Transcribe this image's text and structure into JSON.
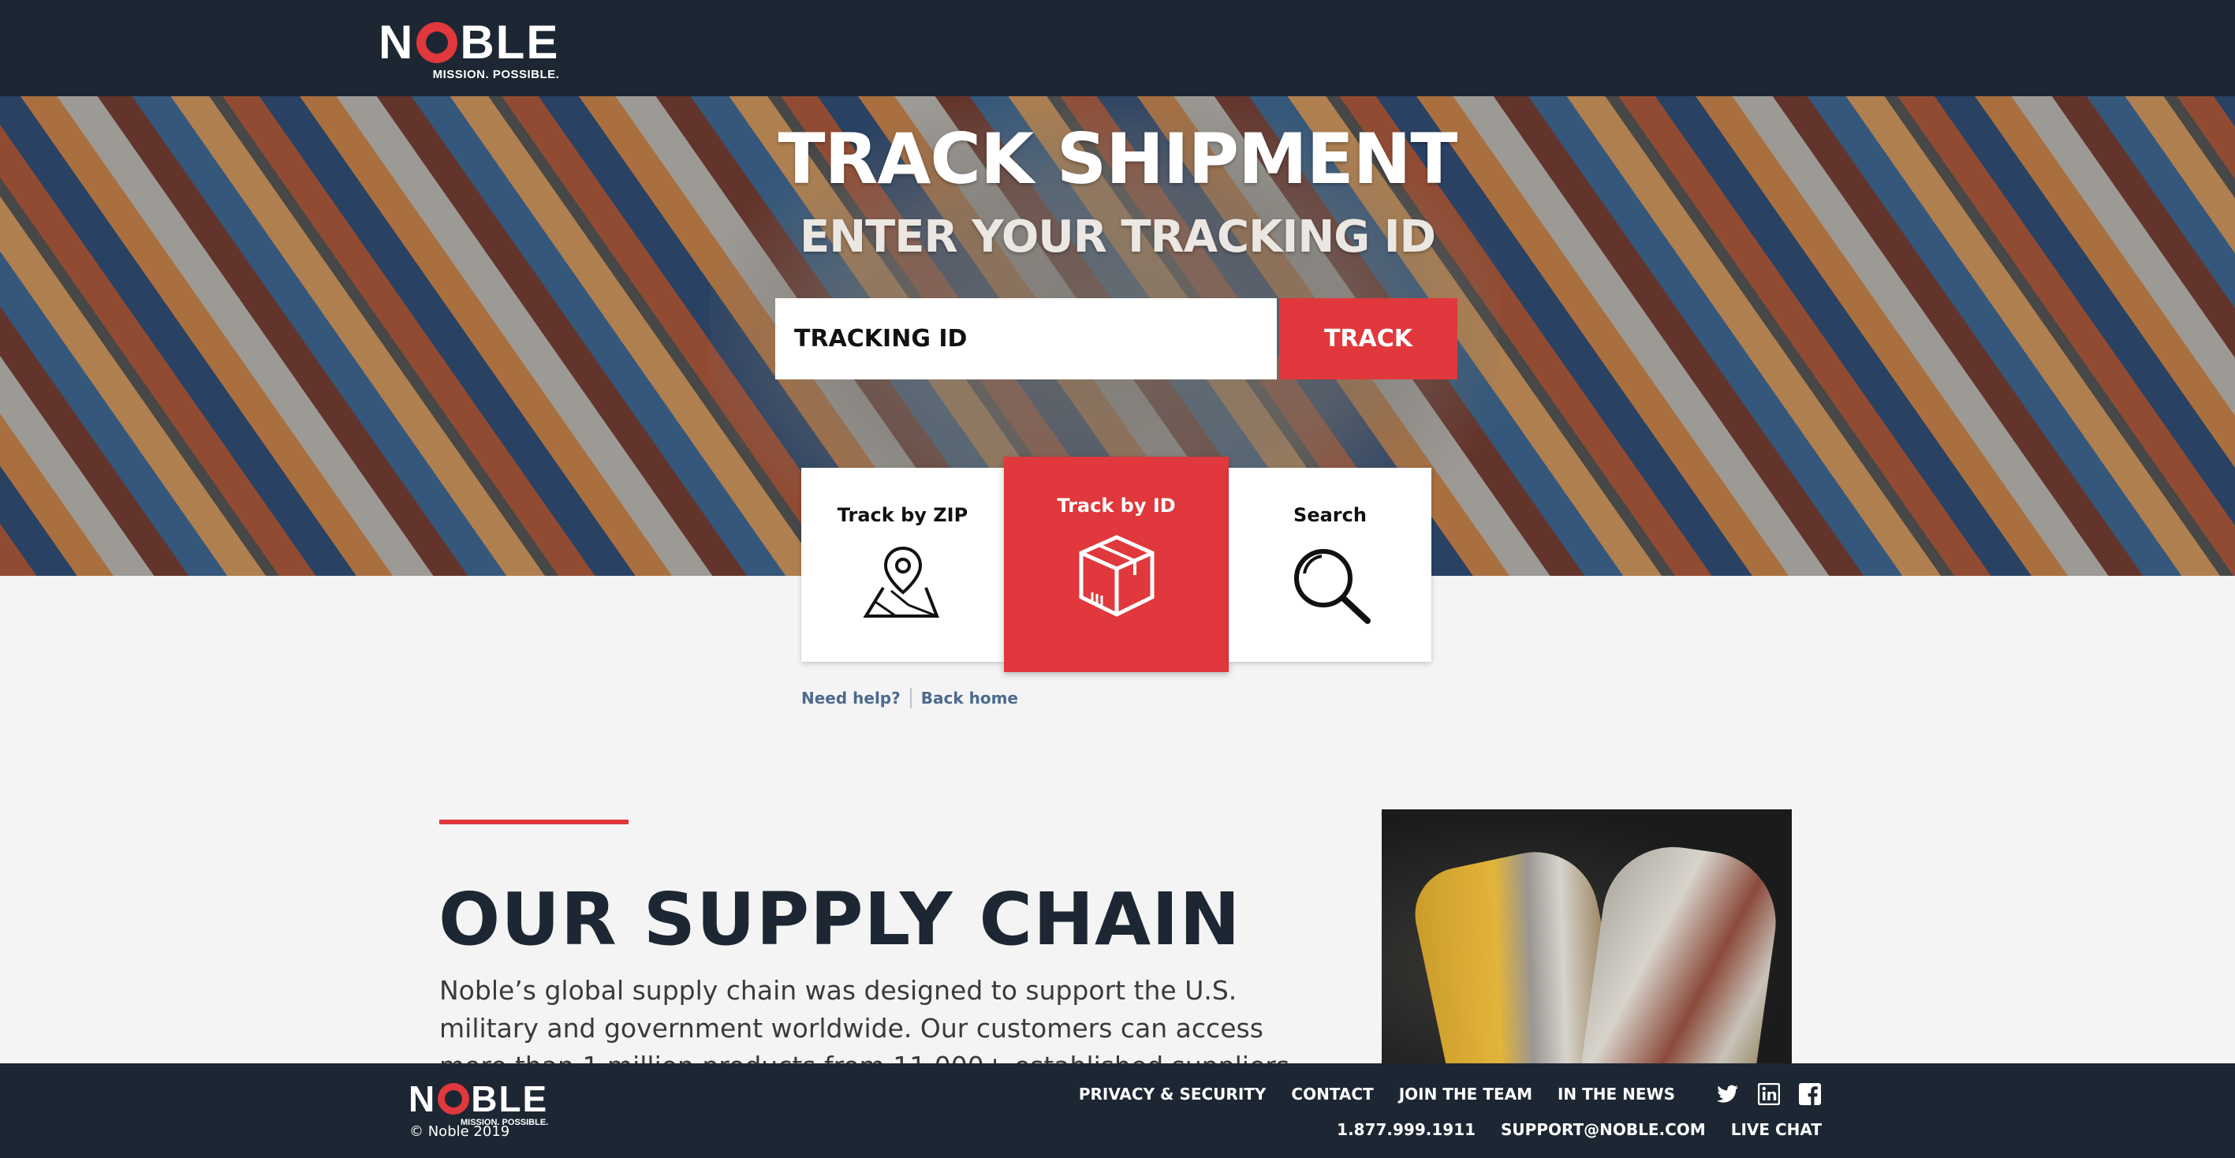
{
  "brand": {
    "logo_word_start": "N",
    "logo_word_end": "BLE",
    "logo_tagline": "MISSION. POSSIBLE.",
    "accent_color": "#e0383c",
    "navy_color": "#1d2733"
  },
  "hero": {
    "title": "TRACK SHIPMENT",
    "subtitle": "ENTER YOUR TRACKING ID",
    "input_placeholder": "TRACKING ID",
    "track_button": "TRACK"
  },
  "modes": [
    {
      "label": "Track by ZIP",
      "icon": "map-pin-icon",
      "active": false
    },
    {
      "label": "Track by ID",
      "icon": "package-box-icon",
      "active": true
    },
    {
      "label": "Search",
      "icon": "magnifier-icon",
      "active": false
    }
  ],
  "help": {
    "need_help": "Need help?",
    "back_home": "Back home"
  },
  "section": {
    "title": "OUR SUPPLY CHAIN",
    "body": "Noble’s global supply chain was designed to support the U.S. military and government worldwide. Our customers can access more than 1 million products from 11,000+ established suppliers including many of the most"
  },
  "footer": {
    "copyright": "© Noble 2019",
    "nav": [
      "PRIVACY & SECURITY",
      "CONTACT",
      "JOIN THE TEAM",
      "IN THE NEWS"
    ],
    "phone": "1.877.999.1911",
    "email": "SUPPORT@NOBLE.COM",
    "live_chat": "LIVE CHAT",
    "social": [
      "twitter-icon",
      "linkedin-icon",
      "facebook-icon"
    ]
  }
}
